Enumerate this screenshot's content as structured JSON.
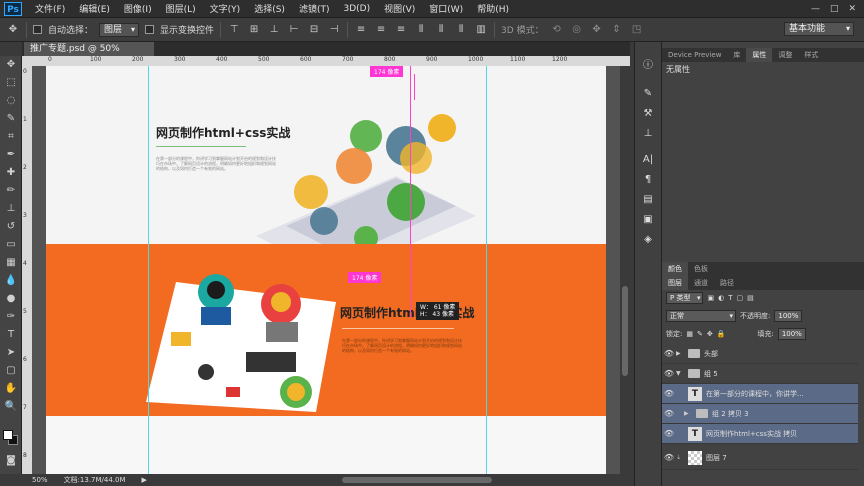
{
  "app": {
    "logo": "Ps"
  },
  "menu": [
    "文件(F)",
    "编辑(E)",
    "图像(I)",
    "图层(L)",
    "文字(Y)",
    "选择(S)",
    "滤镜(T)",
    "3D(D)",
    "视图(V)",
    "窗口(W)",
    "帮助(H)"
  ],
  "window_controls": [
    "—",
    "□",
    "✕"
  ],
  "options": {
    "auto_select_label": "自动选择：",
    "auto_select_value": "图层",
    "show_transform_label": "显示变换控件",
    "mode_3d_label": "3D 模式：",
    "workspace": "基本功能"
  },
  "document_tab": "推广专题.psd @ 50%(RGB/8) *",
  "ruler_top_labels": [
    "0",
    "100",
    "200",
    "300",
    "400",
    "500",
    "600",
    "700",
    "800",
    "900",
    "1000",
    "1100",
    "1200"
  ],
  "ruler_left_labels": [
    "0",
    "1",
    "2",
    "3",
    "4",
    "5",
    "6",
    "7",
    "8"
  ],
  "canvas": {
    "headline1": "网页制作html+css实战",
    "body1": "在第一部分的课程中，你讲学习到掌握网站计划开启的规划和设计技巧在市场中，了解网页设计的流程，明确如何更好地组织和规划网站的结构，以及如何打造一个有效的网站。",
    "headline2": "网页制作html+css实战",
    "body2": "在第一部分的课程中，你讲学习到掌握网站计划开启的规划和设计技巧在市场中，了解网页设计的流程，明确如何更好地组织和规划网站的结构，以及如何打造一个有效的网站。",
    "measure_top": "174 像素",
    "measure_mid": "174 像素",
    "hud_w": "W： 61 像素",
    "hud_h": "H： 43 像素"
  },
  "status": {
    "zoom": "50%",
    "doc": "文档:13.7M/44.0M"
  },
  "panels": {
    "top_tabs": [
      "Device Preview",
      "库",
      "属性",
      "调整",
      "样式"
    ],
    "properties_text": "无属性",
    "color_tabs": [
      "颜色",
      "色板"
    ],
    "layer_tabs": [
      "图层",
      "通道",
      "路径"
    ],
    "kind_filter": "P 类型",
    "blend_mode": "正常",
    "opacity_label": "不透明度:",
    "opacity_value": "100%",
    "lock_label": "锁定:",
    "fill_label": "填充:",
    "fill_value": "100%",
    "layers": [
      {
        "name": "头部",
        "type": "group",
        "expanded": false,
        "selected": false
      },
      {
        "name": "组 5",
        "type": "group",
        "expanded": true,
        "selected": false
      },
      {
        "name": "在第一部分的课程中，你讲学...",
        "type": "text",
        "selected": true
      },
      {
        "name": "组 2 拷贝 3",
        "type": "group",
        "expanded": false,
        "selected": true
      },
      {
        "name": "网页制作html+css实战 拷贝",
        "type": "text",
        "selected": true
      },
      {
        "name": "图层 7",
        "type": "pixel",
        "selected": false
      }
    ]
  }
}
